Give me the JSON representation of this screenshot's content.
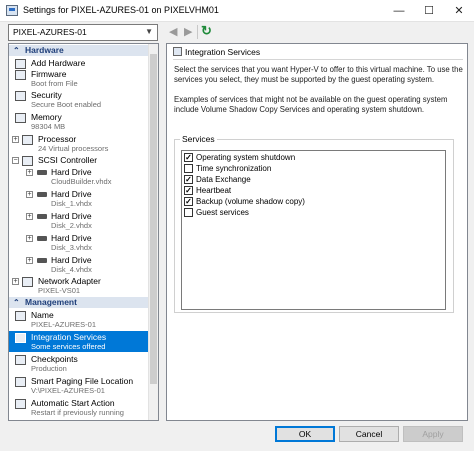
{
  "window": {
    "title": "Settings for PIXEL-AZURES-01 on PIXELVHM01",
    "min": "—",
    "max": "☐",
    "close": "✕"
  },
  "vm_selector": {
    "value": "PIXEL-AZURES-01"
  },
  "nav": {
    "back": "◀",
    "forward": "▶",
    "refresh": "↻"
  },
  "tree": {
    "hardware_header": "Hardware",
    "management_header": "Management",
    "items": [
      {
        "label": "Add Hardware",
        "sub": ""
      },
      {
        "label": "Firmware",
        "sub": "Boot from File"
      },
      {
        "label": "Security",
        "sub": "Secure Boot enabled"
      },
      {
        "label": "Memory",
        "sub": "98304 MB"
      },
      {
        "label": "Processor",
        "sub": "24 Virtual processors"
      },
      {
        "label": "SCSI Controller",
        "sub": ""
      },
      {
        "label": "Hard Drive",
        "sub": "CloudBuilder.vhdx"
      },
      {
        "label": "Hard Drive",
        "sub": "Disk_1.vhdx"
      },
      {
        "label": "Hard Drive",
        "sub": "Disk_2.vhdx"
      },
      {
        "label": "Hard Drive",
        "sub": "Disk_3.vhdx"
      },
      {
        "label": "Hard Drive",
        "sub": "Disk_4.vhdx"
      },
      {
        "label": "Network Adapter",
        "sub": "PIXEL-VS01"
      },
      {
        "label": "Name",
        "sub": "PIXEL-AZURES-01"
      },
      {
        "label": "Integration Services",
        "sub": "Some services offered"
      },
      {
        "label": "Checkpoints",
        "sub": "Production"
      },
      {
        "label": "Smart Paging File Location",
        "sub": "V:\\PIXEL-AZURES-01"
      },
      {
        "label": "Automatic Start Action",
        "sub": "Restart if previously running"
      }
    ]
  },
  "panel": {
    "title": "Integration Services",
    "desc1": "Select the services that you want Hyper-V to offer to this virtual machine. To use the services you select, they must be supported by the guest operating system.",
    "desc2": "Examples of services that might not be available on the guest operating system include Volume Shadow Copy Services and operating system shutdown.",
    "group_label": "Services",
    "services": [
      {
        "label": "Operating system shutdown",
        "checked": true
      },
      {
        "label": "Time synchronization",
        "checked": false
      },
      {
        "label": "Data Exchange",
        "checked": true
      },
      {
        "label": "Heartbeat",
        "checked": true
      },
      {
        "label": "Backup (volume shadow copy)",
        "checked": true
      },
      {
        "label": "Guest services",
        "checked": false
      }
    ],
    "check_glyph": "✓"
  },
  "buttons": {
    "ok": "OK",
    "cancel": "Cancel",
    "apply": "Apply"
  }
}
